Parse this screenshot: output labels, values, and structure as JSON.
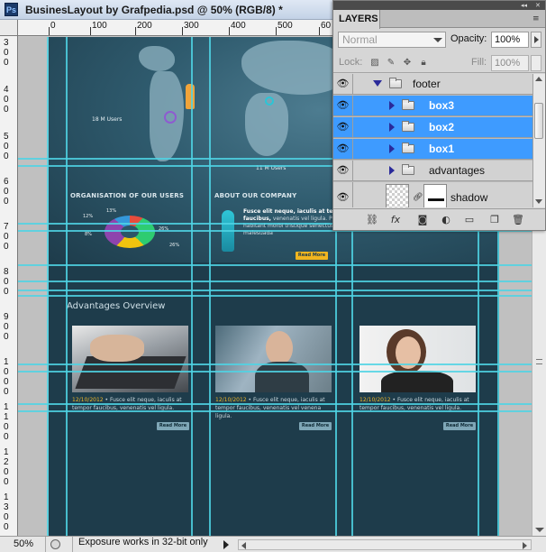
{
  "window": {
    "app_icon": "Ps",
    "title": "BusinesLayout by Grafpedia.psd @ 50% (RGB/8) *"
  },
  "ruler": {
    "top_labels": [
      "0",
      "100",
      "200",
      "300",
      "400",
      "500",
      "60"
    ],
    "left_labels": [
      "300",
      "400",
      "500",
      "600",
      "700",
      "800",
      "900",
      "1000",
      "1100",
      "1200",
      "1300"
    ]
  },
  "document": {
    "map_label_1": "18 M Users",
    "map_label_2": "11 M Users",
    "org_heading": "ORGANISATION OF OUR USERS",
    "org_percents": [
      "12%",
      "13%",
      "8%",
      "26%",
      "26%"
    ],
    "about_heading": "ABOUT OUR COMPANY",
    "about_text_bold": "Fusce elit neque, iaculis at tempor faucibus,",
    "about_text": "venenatis vel ligula. Pellentesque habitant morbi tristique senectus et netus et malesuada",
    "read_more": "Read More",
    "advantages_title": "Advantages Overview",
    "adv_items": [
      {
        "date": "12/10/2012",
        "text": "Fusce elit neque, iaculis at tempor faucibus, venenatis vel ligula."
      },
      {
        "date": "12/10/2012",
        "text": "Fusce elit neque, iaculis at tempor faucibus, venenatis vel venena ligula."
      },
      {
        "date": "12/10/2012",
        "text": "Fusce elit neque, iaculis at tempor faucibus, venenatis vel ligula."
      }
    ]
  },
  "status": {
    "zoom": "50%",
    "message": "Exposure works in 32-bit only"
  },
  "layers_panel": {
    "tab_label": "LAYERS",
    "blend_mode": "Normal",
    "opacity_label": "Opacity:",
    "opacity_value": "100%",
    "lock_label": "Lock:",
    "fill_label": "Fill:",
    "fill_value": "100%",
    "layers": [
      {
        "name": "footer",
        "type": "group",
        "expanded": true,
        "selected": false
      },
      {
        "name": "box3",
        "type": "group",
        "expanded": false,
        "selected": true
      },
      {
        "name": "box2",
        "type": "group",
        "expanded": false,
        "selected": true
      },
      {
        "name": "box1",
        "type": "group",
        "expanded": false,
        "selected": true
      },
      {
        "name": "advantages",
        "type": "group",
        "expanded": false,
        "selected": false
      },
      {
        "name": "shadow",
        "type": "layer",
        "expanded": false,
        "selected": false
      }
    ],
    "footer_icons": [
      "link-layers-icon",
      "fx-icon",
      "add-mask-icon",
      "adjustment-layer-icon",
      "new-group-icon",
      "new-layer-icon",
      "trash-icon"
    ],
    "footer_fx": "fx"
  },
  "colors": {
    "selection": "#3e9bff",
    "guides": "#4fd4e4",
    "doc_bg": "#1e3c4b",
    "accent_button": "#f1b51f"
  }
}
